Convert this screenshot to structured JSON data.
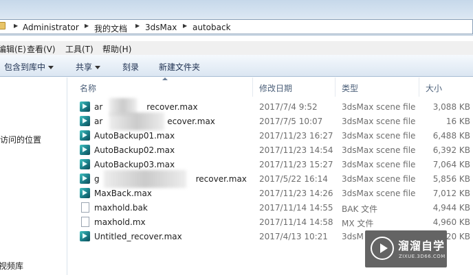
{
  "address": {
    "crumbs": [
      "Administrator",
      "我的文档",
      "3dsMax",
      "autoback"
    ]
  },
  "menu": {
    "items": [
      "编辑(E)",
      "查看(V)",
      "工具(T)",
      "帮助(H)"
    ]
  },
  "toolbar": {
    "include_library": "包含到库中",
    "share": "共享",
    "burn": "刻录",
    "new_folder": "新建文件夹"
  },
  "nav": {
    "recent_places": "访问的位置",
    "videos": "视频库"
  },
  "columns": {
    "name": "名称",
    "date": "修改日期",
    "type": "类型",
    "size": "大小"
  },
  "files": [
    {
      "name": "ar",
      "name_tail": "recover.max",
      "date": "2017/7/4 9:52",
      "type": "3dsMax scene file",
      "size": "3,088 KB",
      "icon": "max-file-icon",
      "blurred": true
    },
    {
      "name": "ar",
      "name_tail": "ecover.max",
      "date": "2017/7/5 10:07",
      "type": "3dsMax scene file",
      "size": "16 KB",
      "icon": "max-file-icon",
      "blurred": true
    },
    {
      "name": "AutoBackup01.max",
      "name_tail": "",
      "date": "2017/11/23 16:27",
      "type": "3dsMax scene file",
      "size": "6,488 KB",
      "icon": "max-file-icon",
      "blurred": false
    },
    {
      "name": "AutoBackup02.max",
      "name_tail": "",
      "date": "2017/11/23 14:54",
      "type": "3dsMax scene file",
      "size": "6,392 KB",
      "icon": "max-file-icon",
      "blurred": false
    },
    {
      "name": "AutoBackup03.max",
      "name_tail": "",
      "date": "2017/11/23 15:27",
      "type": "3dsMax scene file",
      "size": "7,064 KB",
      "icon": "max-file-icon",
      "blurred": false
    },
    {
      "name": "g",
      "name_tail": "recover.max",
      "date": "2017/5/22 16:14",
      "type": "3dsMax scene file",
      "size": "5,856 KB",
      "icon": "max-file-icon",
      "blurred": true
    },
    {
      "name": "MaxBack.max",
      "name_tail": "",
      "date": "2017/11/23 14:26",
      "type": "3dsMax scene file",
      "size": "7,012 KB",
      "icon": "max-file-icon",
      "blurred": false
    },
    {
      "name": "maxhold.bak",
      "name_tail": "",
      "date": "2017/11/14 14:55",
      "type": "BAK 文件",
      "size": "4,944 KB",
      "icon": "document-icon",
      "blurred": false
    },
    {
      "name": "maxhold.mx",
      "name_tail": "",
      "date": "2017/11/14 14:58",
      "type": "MX 文件",
      "size": "4,960 KB",
      "icon": "document-icon",
      "blurred": false
    },
    {
      "name": "Untitled_recover.max",
      "name_tail": "",
      "date": "2017/4/13 10:21",
      "type": "3dsM",
      "size": "20 KB",
      "icon": "max-file-icon",
      "blurred": false
    }
  ],
  "watermark": {
    "title": "溜溜自学",
    "subtitle": "ZIXUE.3D66.COM"
  }
}
